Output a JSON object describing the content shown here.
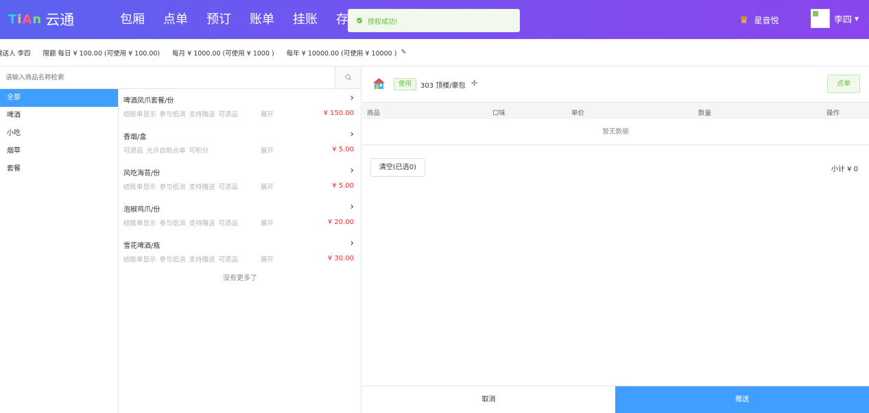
{
  "header": {
    "logo_mark": "TiAn",
    "logo_text": "云通",
    "nav": [
      "包厢",
      "点单",
      "预订",
      "账单",
      "挂账",
      "存"
    ],
    "toast": "授权成功!",
    "brand": "星音悦",
    "user": "李四",
    "colors": {
      "gradient_start": "#5b62f0",
      "gradient_end": "#8a46ee",
      "toast_green": "#67c23a"
    }
  },
  "limits": {
    "giver": "赠送人 李四",
    "daily": "限额 每日 ¥ 100.00 (可使用 ¥ 100.00)",
    "monthly": "每月 ¥ 1000.00 (可使用 ¥ 1000 )",
    "yearly": "每年 ¥ 10000.00 (可使用 ¥ 10000 )"
  },
  "search": {
    "placeholder": "请输入商品名称检索"
  },
  "categories": [
    "全部",
    "啤酒",
    "小吃",
    "烟草",
    "套餐"
  ],
  "products": [
    {
      "name": "啤酒凤爪套餐/份",
      "tags": [
        "结账单显示",
        "参与低消",
        "支持赠送",
        "可退品"
      ],
      "expand": "展开",
      "price": "¥ 150.00"
    },
    {
      "name": "香烟/盒",
      "tags": [
        "可退品",
        "允许自助点单",
        "可积分"
      ],
      "expand": "展开",
      "price": "¥ 5.00"
    },
    {
      "name": "风吃海苔/份",
      "tags": [
        "结账单显示",
        "参与低消",
        "支持赠送",
        "可退品"
      ],
      "expand": "展开",
      "price": "¥ 5.00"
    },
    {
      "name": "泡椒鸡爪/份",
      "tags": [
        "结账单显示",
        "参与低消",
        "支持赠送",
        "可退品"
      ],
      "expand": "展开",
      "price": "¥ 20.00"
    },
    {
      "name": "雪花啤酒/瓶",
      "tags": [
        "结账单显示",
        "参与低消",
        "支持赠送",
        "可退品"
      ],
      "expand": "展开",
      "price": "¥ 30.00"
    }
  ],
  "no_more": "没有更多了",
  "room": {
    "badge": "使用",
    "label": "303 顶楼/豪包",
    "order_button": "点单"
  },
  "table": {
    "columns": [
      "商品",
      "口味",
      "单价",
      "数量",
      "操作"
    ],
    "empty": "暂无数据"
  },
  "clear_button": "清空(已选0)",
  "subtotal": "小计 ¥ 0",
  "footer": {
    "cancel": "取消",
    "gift": "赠送"
  }
}
